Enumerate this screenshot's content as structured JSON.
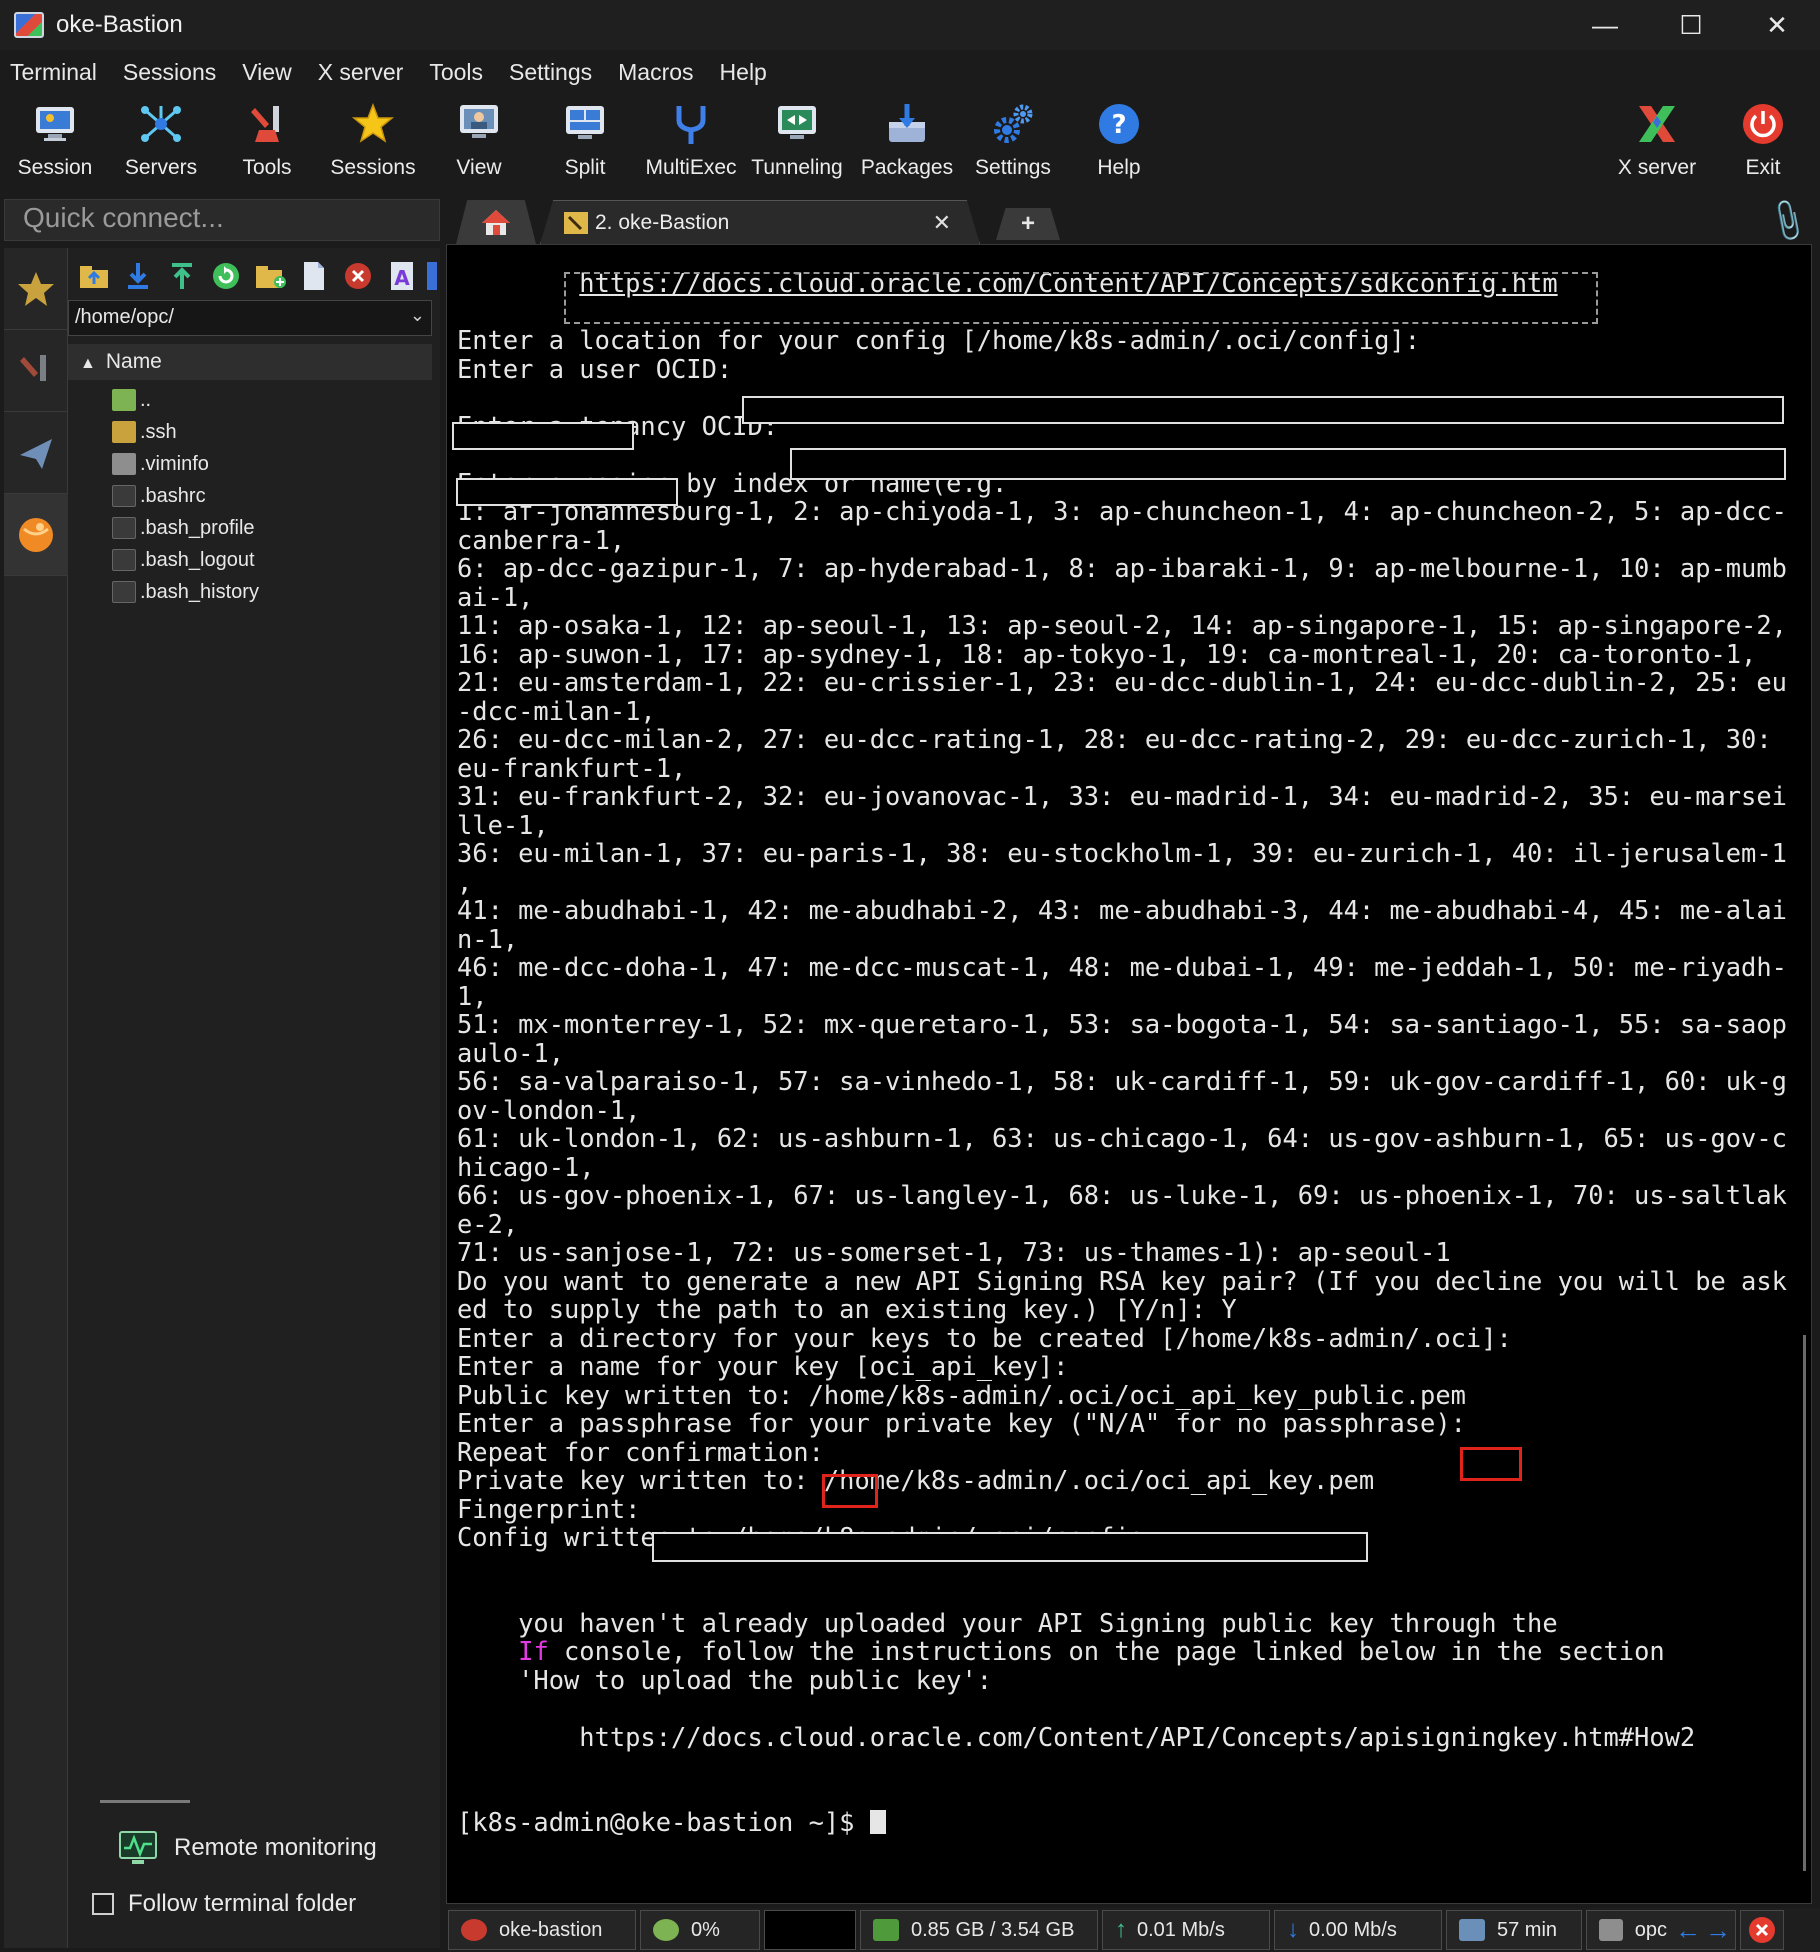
{
  "window": {
    "title": "oke-Bastion",
    "controls": [
      "—",
      "☐",
      "✕"
    ]
  },
  "menu": [
    "Terminal",
    "Sessions",
    "View",
    "X server",
    "Tools",
    "Settings",
    "Macros",
    "Help"
  ],
  "toolbar": {
    "session": "Session",
    "servers": "Servers",
    "tools": "Tools",
    "sessions": "Sessions",
    "view": "View",
    "split": "Split",
    "multiexec": "MultiExec",
    "tunneling": "Tunneling",
    "packages": "Packages",
    "settings": "Settings",
    "help": "Help",
    "xserver": "X server",
    "exit": "Exit"
  },
  "quick_connect": {
    "placeholder": "Quick connect..."
  },
  "file_browser": {
    "path": "/home/opc/",
    "column": "Name",
    "files": [
      {
        "name": "..",
        "kind": "up"
      },
      {
        "name": ".ssh",
        "kind": "folder"
      },
      {
        "name": ".viminfo",
        "kind": "doc"
      },
      {
        "name": ".bashrc",
        "kind": "term"
      },
      {
        "name": ".bash_profile",
        "kind": "term"
      },
      {
        "name": ".bash_logout",
        "kind": "term"
      },
      {
        "name": ".bash_history",
        "kind": "term"
      }
    ]
  },
  "bottom_panel": {
    "remote_monitoring": "Remote monitoring",
    "follow_folder": "Follow terminal folder"
  },
  "tabs": {
    "active": "2. oke-Bastion",
    "close": "✕",
    "new": "+"
  },
  "terminal": {
    "lines": [
      "        https://docs.cloud.oracle.com/Content/API/Concepts/sdkconfig.htm",
      "",
      "Enter a location for your config [/home/k8s-admin/.oci/config]:",
      "Enter a user OCID:",
      "",
      "Enter a tenancy OCID:",
      "",
      "Enter a region by index or name(e.g.",
      "1: af-johannesburg-1, 2: ap-chiyoda-1, 3: ap-chuncheon-1, 4: ap-chuncheon-2, 5: ap-dcc-",
      "canberra-1,",
      "6: ap-dcc-gazipur-1, 7: ap-hyderabad-1, 8: ap-ibaraki-1, 9: ap-melbourne-1, 10: ap-mumb",
      "ai-1,",
      "11: ap-osaka-1, 12: ap-seoul-1, 13: ap-seoul-2, 14: ap-singapore-1, 15: ap-singapore-2,",
      "16: ap-suwon-1, 17: ap-sydney-1, 18: ap-tokyo-1, 19: ca-montreal-1, 20: ca-toronto-1,",
      "21: eu-amsterdam-1, 22: eu-crissier-1, 23: eu-dcc-dublin-1, 24: eu-dcc-dublin-2, 25: eu",
      "-dcc-milan-1,",
      "26: eu-dcc-milan-2, 27: eu-dcc-rating-1, 28: eu-dcc-rating-2, 29: eu-dcc-zurich-1, 30:",
      "eu-frankfurt-1,",
      "31: eu-frankfurt-2, 32: eu-jovanovac-1, 33: eu-madrid-1, 34: eu-madrid-2, 35: eu-marsei",
      "lle-1,",
      "36: eu-milan-1, 37: eu-paris-1, 38: eu-stockholm-1, 39: eu-zurich-1, 40: il-jerusalem-1",
      ",",
      "41: me-abudhabi-1, 42: me-abudhabi-2, 43: me-abudhabi-3, 44: me-abudhabi-4, 45: me-alai",
      "n-1,",
      "46: me-dcc-doha-1, 47: me-dcc-muscat-1, 48: me-dubai-1, 49: me-jeddah-1, 50: me-riyadh-",
      "1,",
      "51: mx-monterrey-1, 52: mx-queretaro-1, 53: sa-bogota-1, 54: sa-santiago-1, 55: sa-saop",
      "aulo-1,",
      "56: sa-valparaiso-1, 57: sa-vinhedo-1, 58: uk-cardiff-1, 59: uk-gov-cardiff-1, 60: uk-g",
      "ov-london-1,",
      "61: uk-london-1, 62: us-ashburn-1, 63: us-chicago-1, 64: us-gov-ashburn-1, 65: us-gov-c",
      "hicago-1,",
      "66: us-gov-phoenix-1, 67: us-langley-1, 68: us-luke-1, 69: us-phoenix-1, 70: us-saltlak",
      "e-2,",
      "71: us-sanjose-1, 72: us-somerset-1, 73: us-thames-1): ap-seoul-1",
      "Do you want to generate a new API Signing RSA key pair? (If you decline you will be ask",
      "ed to supply the path to an existing key.) [Y/n]: Y",
      "Enter a directory for your keys to be created [/home/k8s-admin/.oci]:",
      "Enter a name for your key [oci_api_key]:",
      "Public key written to: /home/k8s-admin/.oci/oci_api_key_public.pem",
      "Enter a passphrase for your private key (\"N/A\" for no passphrase):",
      "Repeat for confirmation:",
      "Private key written to: /home/k8s-admin/.oci/oci_api_key.pem",
      "Fingerprint:",
      "Config written to /home/k8s-admin/.oci/config",
      "",
      "",
      "    you haven't already uploaded your API Signing public key through the",
      "    console, follow the instructions on the page linked below in the section",
      "    'How to upload the public key':",
      "",
      "        https://docs.cloud.oracle.com/Content/API/Concepts/apisigningkey.htm#How2",
      "",
      "",
      "[k8s-admin@oke-bastion ~]$ "
    ],
    "if_keyword": "If",
    "link_lines": [
      0,
      52
    ]
  },
  "statusbar": {
    "host": "oke-bastion",
    "cpu": "0%",
    "memory": "0.85 GB / 3.54 GB",
    "upload": "0.01 Mb/s",
    "download": "0.00 Mb/s",
    "uptime": "57 min",
    "user": "opc"
  },
  "icons": {
    "session": "monitor-icon",
    "servers": "network-icon",
    "tools": "tools-icon",
    "sessions": "star-icon",
    "view": "view-icon",
    "split": "split-icon",
    "multiexec": "fork-icon",
    "tunneling": "tunnel-icon",
    "packages": "package-icon",
    "settings": "gears-icon",
    "help": "help-icon",
    "xserver": "x-icon",
    "exit": "power-icon"
  },
  "colors": {
    "accent_blue": "#2f7be3",
    "exit_red": "#e53a2e",
    "highlight_red": "#e0241c",
    "keyword_magenta": "#e33be3"
  }
}
